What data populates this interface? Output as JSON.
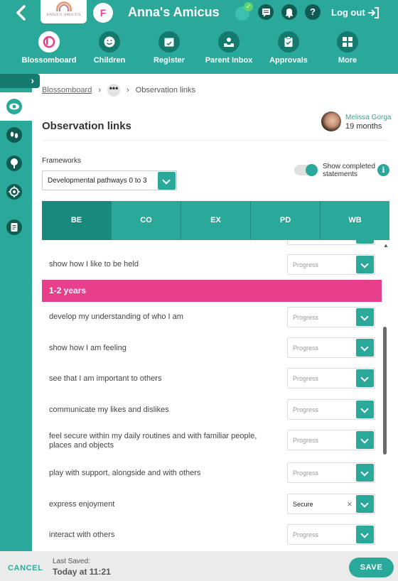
{
  "header": {
    "logo_text": "ANNA'S AMICUS",
    "user_initial": "F",
    "app_title": "Anna's Amicus",
    "logout_label": "Log out",
    "icons": [
      "back-chevron-icon",
      "sync-status-icon",
      "messages-icon",
      "notifications-icon",
      "help-icon",
      "logout-icon"
    ]
  },
  "nav": {
    "items": [
      {
        "label": "Blossomboard",
        "icon": "blossomboard-icon",
        "active": true
      },
      {
        "label": "Children",
        "icon": "smiley-icon"
      },
      {
        "label": "Register",
        "icon": "calendar-check-icon"
      },
      {
        "label": "Parent Inbox",
        "icon": "inbox-icon"
      },
      {
        "label": "Approvals",
        "icon": "clipboard-check-icon"
      },
      {
        "label": "More",
        "icon": "grid-icon"
      }
    ]
  },
  "sidebar": {
    "items": [
      "eye-icon",
      "footprints-icon",
      "tree-icon",
      "target-icon",
      "document-icon"
    ]
  },
  "breadcrumb": {
    "root": "Blossomboard",
    "more": "•••",
    "current": "Observation links"
  },
  "page": {
    "title": "Observation links",
    "child_name": "Melissa Gorga",
    "child_age": "19 months"
  },
  "frameworks": {
    "label": "Frameworks",
    "selected": "Developmental pathways 0 to 3",
    "toggle_label": "Show completed statements",
    "toggle_on": true
  },
  "tabs": [
    "BE",
    "CO",
    "EX",
    "PD",
    "WB"
  ],
  "statements": {
    "first": {
      "text": "show how I like to be held",
      "value": "Progress"
    },
    "band": "1-2 years",
    "items": [
      {
        "text": "develop my understanding of who I am",
        "value": "Progress"
      },
      {
        "text": "show how I am feeling",
        "value": "Progress"
      },
      {
        "text": "see that I am important to others",
        "value": "Progress"
      },
      {
        "text": "communicate my likes and dislikes",
        "value": "Progress"
      },
      {
        "text": "feel secure within my daily routines and with familiar people, places and objects",
        "value": "Progress"
      },
      {
        "text": "play with support, alongside and with others",
        "value": "Progress"
      },
      {
        "text": "express enjoyment",
        "value": "Secure"
      },
      {
        "text": "interact with others",
        "value": "Progress"
      }
    ]
  },
  "footer": {
    "cancel": "CANCEL",
    "saved_label": "Last Saved:",
    "saved_time": "Today at 11:21",
    "save": "SAVE"
  },
  "colors": {
    "brand_teal": "#2aa899",
    "dark_teal": "#0f5b52",
    "band_pink": "#e83f8b"
  }
}
